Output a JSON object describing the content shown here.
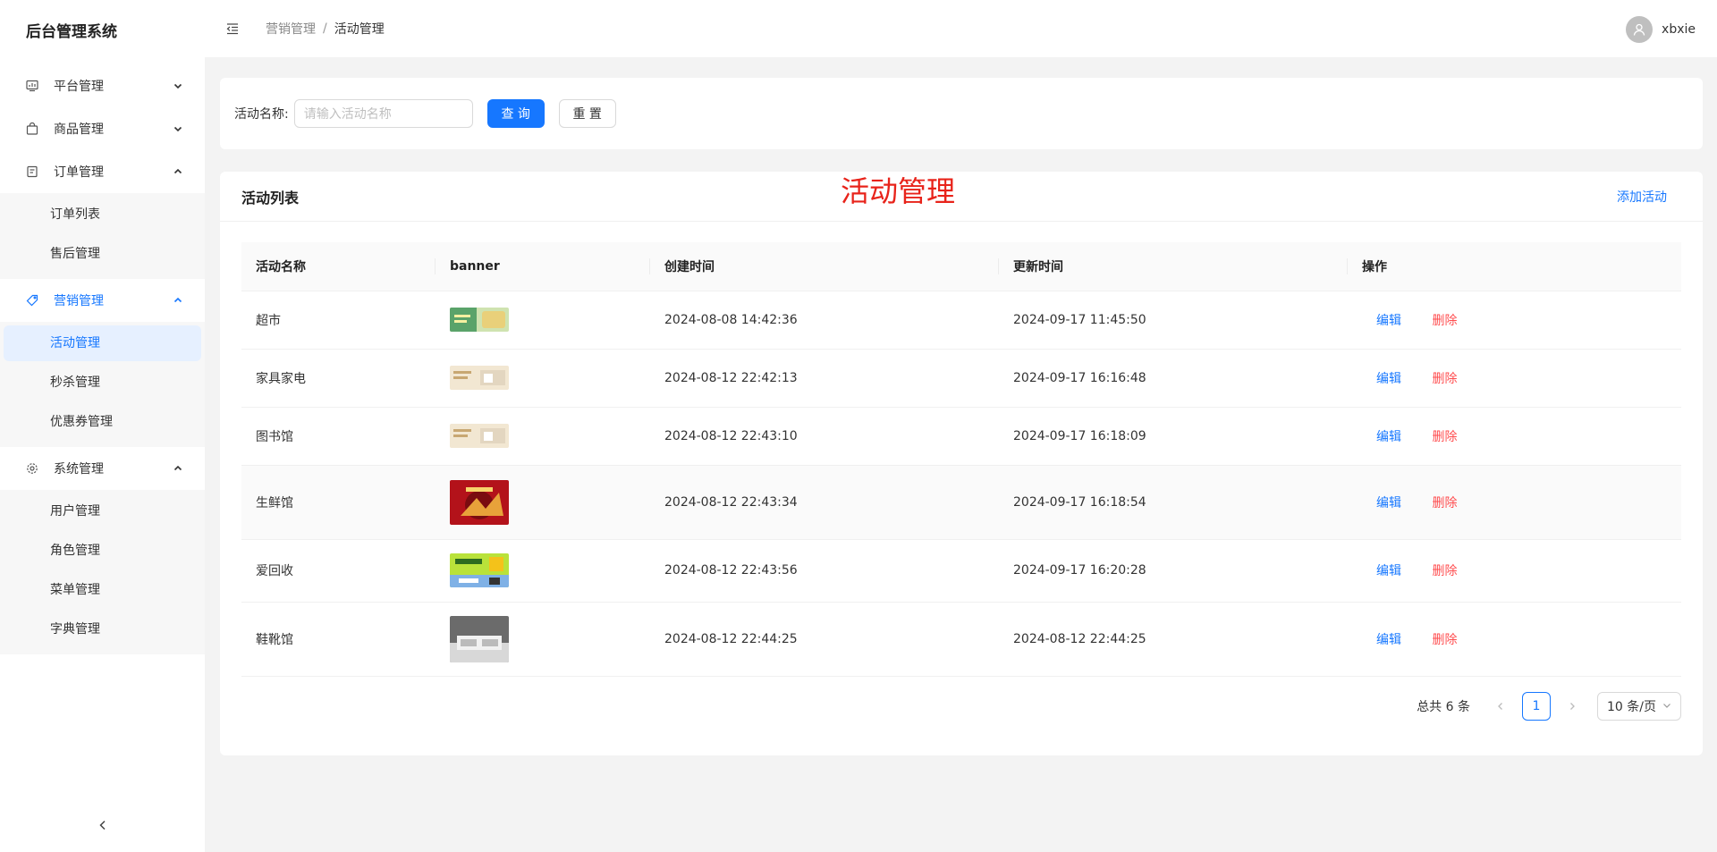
{
  "app": {
    "title": "后台管理系统"
  },
  "sidebar": {
    "groups": [
      {
        "label": "平台管理",
        "icon": "dashboard-icon",
        "expanded": false
      },
      {
        "label": "商品管理",
        "icon": "shopping-bag-icon",
        "expanded": false
      },
      {
        "label": "订单管理",
        "icon": "order-icon",
        "expanded": true,
        "items": [
          {
            "label": "订单列表"
          },
          {
            "label": "售后管理"
          }
        ]
      },
      {
        "label": "营销管理",
        "icon": "tag-icon",
        "expanded": true,
        "active": true,
        "items": [
          {
            "label": "活动管理",
            "active": true
          },
          {
            "label": "秒杀管理"
          },
          {
            "label": "优惠券管理"
          }
        ]
      },
      {
        "label": "系统管理",
        "icon": "gear-icon",
        "expanded": true,
        "items": [
          {
            "label": "用户管理"
          },
          {
            "label": "角色管理"
          },
          {
            "label": "菜单管理"
          },
          {
            "label": "字典管理"
          }
        ]
      }
    ]
  },
  "header": {
    "breadcrumb": [
      "营销管理",
      "活动管理"
    ],
    "separator": "/",
    "username": "xbxie"
  },
  "search": {
    "label": "活动名称:",
    "placeholder": "请输入活动名称",
    "value": "",
    "query_label": "查 询",
    "reset_label": "重 置"
  },
  "list": {
    "title": "活动列表",
    "overlay_title": "活动管理",
    "add_label": "添加活动",
    "columns": [
      "活动名称",
      "banner",
      "创建时间",
      "更新时间",
      "操作"
    ],
    "rows": [
      {
        "name": "超市",
        "created": "2024-08-08 14:42:36",
        "updated": "2024-09-17 11:45:50",
        "edit": "编辑",
        "delete": "删除"
      },
      {
        "name": "家具家电",
        "created": "2024-08-12 22:42:13",
        "updated": "2024-09-17 16:16:48",
        "edit": "编辑",
        "delete": "删除"
      },
      {
        "name": "图书馆",
        "created": "2024-08-12 22:43:10",
        "updated": "2024-09-17 16:18:09",
        "edit": "编辑",
        "delete": "删除"
      },
      {
        "name": "生鲜馆",
        "created": "2024-08-12 22:43:34",
        "updated": "2024-09-17 16:18:54",
        "edit": "编辑",
        "delete": "删除"
      },
      {
        "name": "爱回收",
        "created": "2024-08-12 22:43:56",
        "updated": "2024-09-17 16:20:28",
        "edit": "编辑",
        "delete": "删除"
      },
      {
        "name": "鞋靴馆",
        "created": "2024-08-12 22:44:25",
        "updated": "2024-08-12 22:44:25",
        "edit": "编辑",
        "delete": "删除"
      }
    ]
  },
  "pagination": {
    "total": "总共 6 条",
    "current": "1",
    "page_size": "10 条/页"
  },
  "colors": {
    "primary": "#1677ff",
    "danger": "#ff4d4f",
    "overlay": "#e8231a"
  }
}
